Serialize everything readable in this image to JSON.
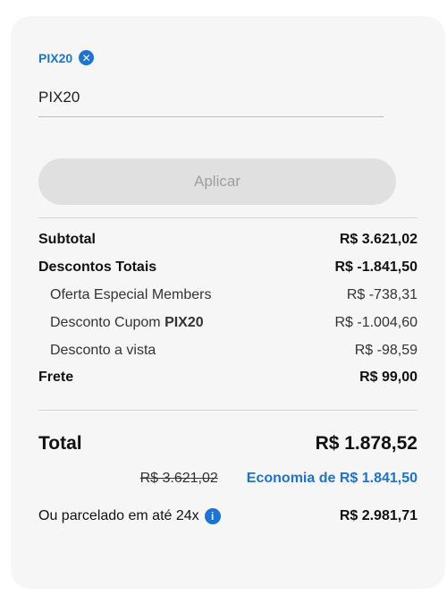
{
  "coupon": {
    "applied_code": "PIX20",
    "input_value": "PIX20",
    "apply_label": "Aplicar"
  },
  "summary": {
    "subtotal_label": "Subtotal",
    "subtotal_value": "R$ 3.621,02",
    "discounts_label": "Descontos Totais",
    "discounts_value": "R$ -1.841,50",
    "discount_items": [
      {
        "label": "Oferta Especial Members",
        "code": "",
        "value": "R$ -738,31"
      },
      {
        "label": "Desconto Cupom ",
        "code": "PIX20",
        "value": "R$ -1.004,60"
      },
      {
        "label": "Desconto a vista",
        "code": "",
        "value": "R$ -98,59"
      }
    ],
    "shipping_label": "Frete",
    "shipping_value": "R$ 99,00"
  },
  "total": {
    "label": "Total",
    "value": "R$ 1.878,52",
    "original_price": "R$ 3.621,02",
    "economy_text": "Economia de R$ 1.841,50",
    "installments_label": "Ou parcelado em até 24x",
    "installments_value": "R$ 2.981,71"
  },
  "icons": {
    "remove_coupon": "close-icon",
    "installments_info": "info-icon"
  },
  "colors": {
    "accent": "#1a73d8",
    "card_background": "#f6f6f6",
    "button_disabled": "#e0e0e0"
  }
}
